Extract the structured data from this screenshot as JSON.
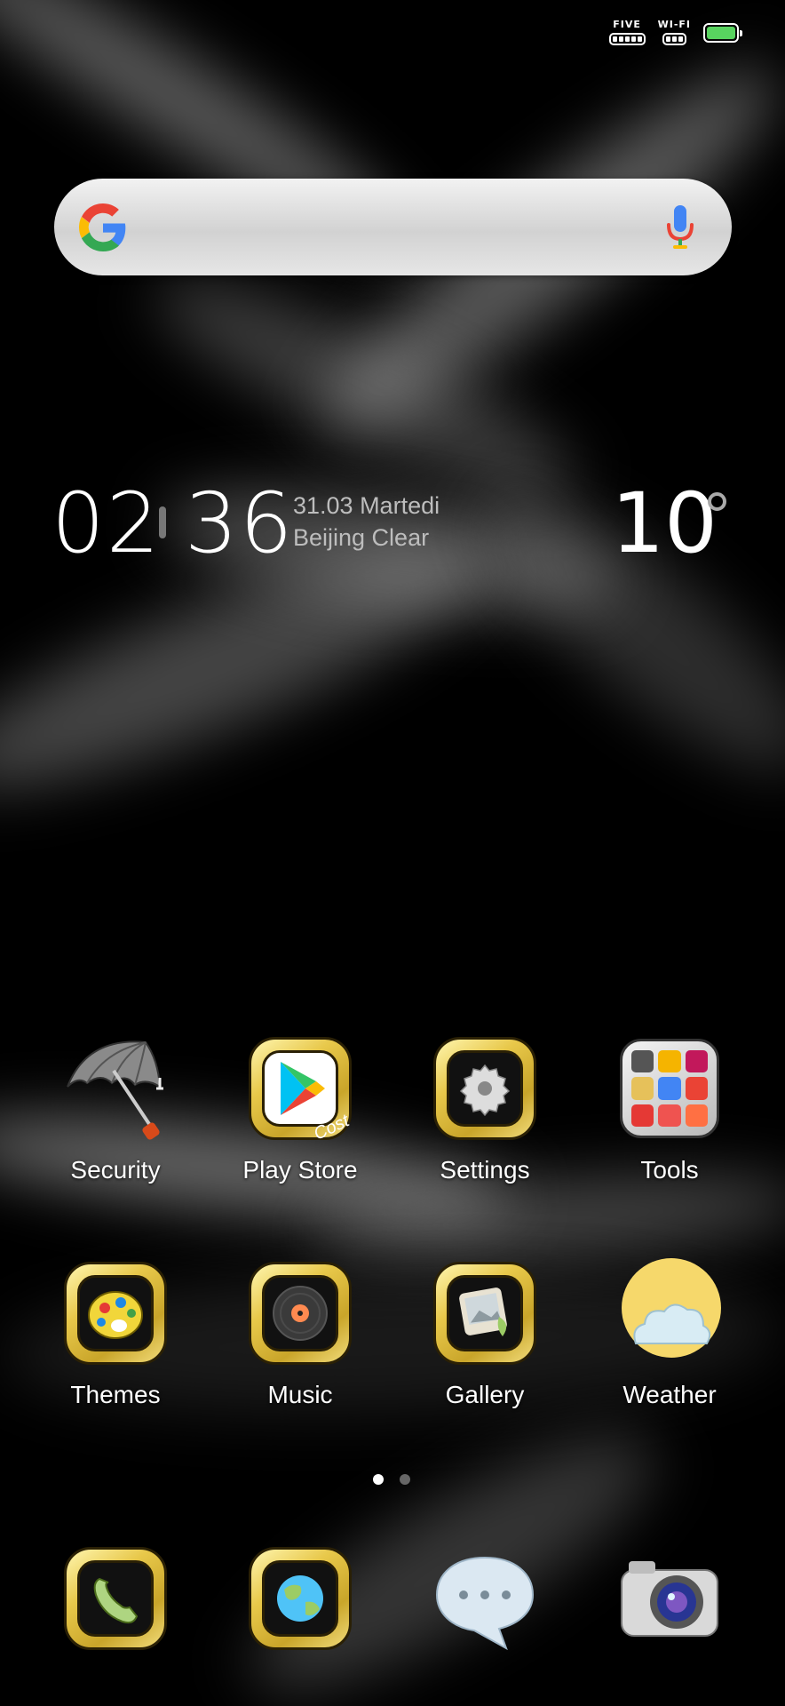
{
  "status_bar": {
    "carrier_label": "FIVE",
    "wifi_label": "WI-FI",
    "battery_color": "#58d35f"
  },
  "search_bar": {
    "logo_icon": "google-g-icon",
    "mic_icon": "microphone-icon"
  },
  "clock_widget": {
    "hours": "02",
    "minutes": "36",
    "date": "31.03 Martedi",
    "weather": "Beijing Clear",
    "temperature": "10"
  },
  "apps_row1": [
    {
      "label": "Security",
      "icon": "umbrella-icon"
    },
    {
      "label": "Play Store",
      "icon": "play-store-icon"
    },
    {
      "label": "Settings",
      "icon": "gear-icon"
    },
    {
      "label": "Tools",
      "icon": "tools-folder-icon"
    }
  ],
  "apps_row2": [
    {
      "label": "Themes",
      "icon": "palette-icon"
    },
    {
      "label": "Music",
      "icon": "vinyl-record-icon"
    },
    {
      "label": "Gallery",
      "icon": "photo-icon"
    },
    {
      "label": "Weather",
      "icon": "sun-cloud-icon"
    }
  ],
  "dock": [
    {
      "icon": "phone-icon"
    },
    {
      "icon": "globe-icon"
    },
    {
      "icon": "chat-bubble-icon"
    },
    {
      "icon": "camera-icon"
    }
  ],
  "page_indicator": {
    "total": 2,
    "current": 1
  },
  "play_store_badge": "Cost"
}
